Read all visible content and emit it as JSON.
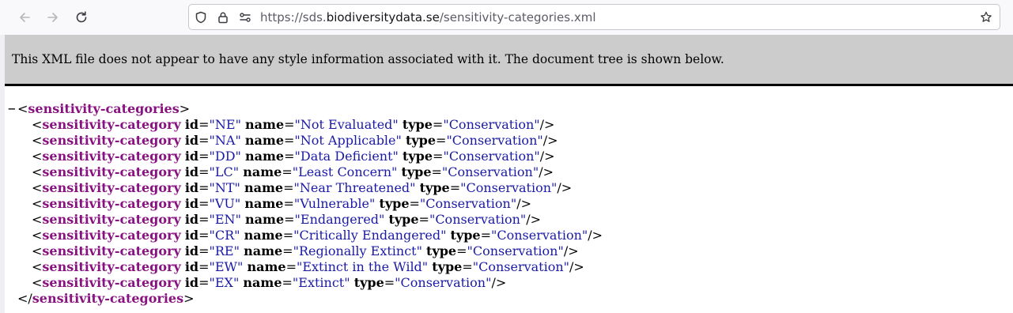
{
  "browser": {
    "url_prefix": "https://sds.",
    "url_domain": "biodiversitydata.se",
    "url_path": "/sensitivity-categories.xml"
  },
  "info_banner": "This XML file does not appear to have any style information associated with it. The document tree is shown below.",
  "xml": {
    "collapse_glyph": "−",
    "root_tag": "sensitivity-categories",
    "child_tag": "sensitivity-category",
    "items": [
      {
        "id": "NE",
        "name": "Not Evaluated",
        "type": "Conservation"
      },
      {
        "id": "NA",
        "name": "Not Applicable",
        "type": "Conservation"
      },
      {
        "id": "DD",
        "name": "Data Deficient",
        "type": "Conservation"
      },
      {
        "id": "LC",
        "name": "Least Concern",
        "type": "Conservation"
      },
      {
        "id": "NT",
        "name": "Near Threatened",
        "type": "Conservation"
      },
      {
        "id": "VU",
        "name": "Vulnerable",
        "type": "Conservation"
      },
      {
        "id": "EN",
        "name": "Endangered",
        "type": "Conservation"
      },
      {
        "id": "CR",
        "name": "Critically Endangered",
        "type": "Conservation"
      },
      {
        "id": "RE",
        "name": "Regionally Extinct",
        "type": "Conservation"
      },
      {
        "id": "EW",
        "name": "Extinct in the Wild",
        "type": "Conservation"
      },
      {
        "id": "EX",
        "name": "Extinct",
        "type": "Conservation"
      }
    ]
  }
}
